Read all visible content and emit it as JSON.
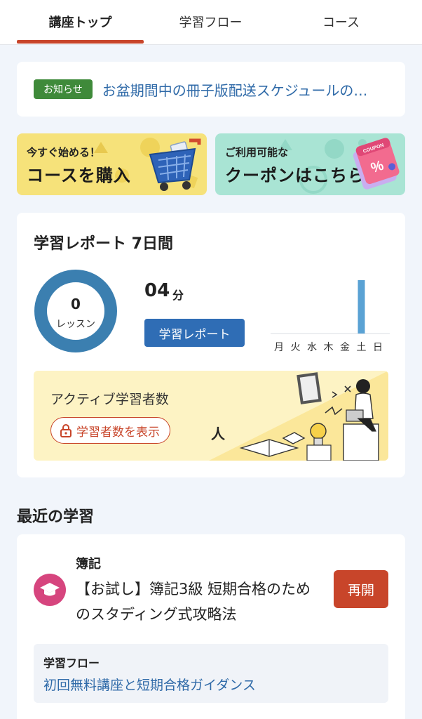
{
  "tabs": [
    {
      "label": "講座トップ",
      "active": true
    },
    {
      "label": "学習フロー",
      "active": false
    },
    {
      "label": "コース",
      "active": false
    }
  ],
  "notice": {
    "badge": "お知らせ",
    "text": "お盆期間中の冊子版配送スケジュールの…"
  },
  "banners": {
    "buy": {
      "small": "今すぐ始める！",
      "big": "コースを購入"
    },
    "coupon": {
      "small": "ご利用可能な",
      "big": "クーポンはこちら",
      "tag": "COUPON"
    }
  },
  "report": {
    "title": "学習レポート 7日間",
    "lessons": "0",
    "lessons_unit": "レッスン",
    "minutes": "04",
    "minutes_unit": "分",
    "button": "学習レポート",
    "days": [
      "月",
      "火",
      "水",
      "木",
      "金",
      "土",
      "日"
    ],
    "daily_minutes_fraction": [
      0,
      0,
      0,
      0,
      0,
      1,
      0
    ],
    "active_title": "アクティブ学習者数",
    "active_button": "学習者数を表示",
    "active_unit": "人"
  },
  "recent": {
    "title": "最近の学習",
    "category": "簿記",
    "course_name": "【お試し】簿記3級 短期合格のためのスタディング式攻略法",
    "resume": "再開",
    "flow_label": "学習フロー",
    "flow_link": "初回無料講座と短期合格ガイダンス"
  },
  "colors": {
    "accent": "#c8452a",
    "link": "#2f6aa8",
    "primary": "#2f6db5",
    "badge_green": "#3f8a3a",
    "donut": "#3b7fb0"
  }
}
